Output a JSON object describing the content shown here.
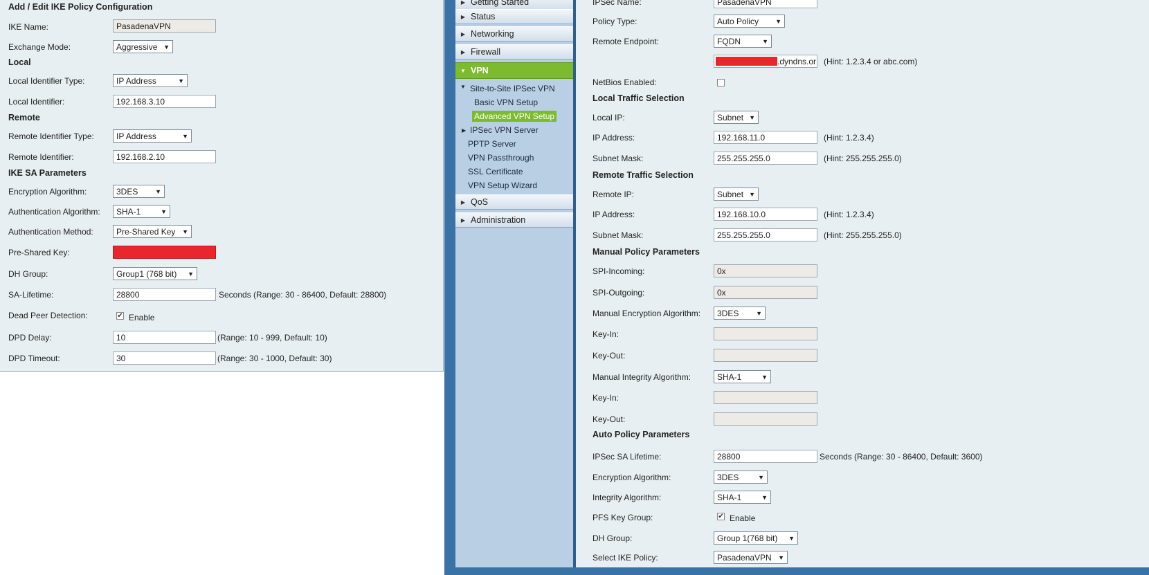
{
  "ike": {
    "title": "Add / Edit IKE Policy Configuration",
    "ike_name_label": "IKE Name:",
    "ike_name_value": "PasadenaVPN",
    "exchange_mode_label": "Exchange Mode:",
    "exchange_mode_value": "Aggressive",
    "local_heading": "Local",
    "local_id_type_label": "Local Identifier Type:",
    "local_id_type_value": "IP Address",
    "local_id_label": "Local Identifier:",
    "local_id_value": "192.168.3.10",
    "remote_heading": "Remote",
    "remote_id_type_label": "Remote Identifier Type:",
    "remote_id_type_value": "IP Address",
    "remote_id_label": "Remote Identifier:",
    "remote_id_value": "192.168.2.10",
    "sa_heading": "IKE SA Parameters",
    "enc_alg_label": "Encryption Algorithm:",
    "enc_alg_value": "3DES",
    "auth_alg_label": "Authentication Algorithm:",
    "auth_alg_value": "SHA-1",
    "auth_method_label": "Authentication Method:",
    "auth_method_value": "Pre-Shared Key",
    "psk_label": "Pre-Shared Key:",
    "dh_label": "DH Group:",
    "dh_value": "Group1 (768 bit)",
    "sa_lifetime_label": "SA-Lifetime:",
    "sa_lifetime_value": "28800",
    "sa_lifetime_hint": "Seconds  (Range: 30 - 86400, Default: 28800)",
    "dpd_label": "Dead Peer Detection:",
    "dpd_enable": "Enable",
    "dpd_delay_label": "DPD Delay:",
    "dpd_delay_value": "10",
    "dpd_delay_hint": "(Range: 10 - 999, Default: 10)",
    "dpd_timeout_label": "DPD Timeout:",
    "dpd_timeout_value": "30",
    "dpd_timeout_hint": "(Range: 30 - 1000, Default: 30)"
  },
  "nav": {
    "getting_started": "Getting Started",
    "status": "Status",
    "networking": "Networking",
    "firewall": "Firewall",
    "vpn": "VPN",
    "site_to_site": "Site-to-Site IPSec VPN",
    "basic_setup": "Basic VPN Setup",
    "advanced_setup": "Advanced VPN Setup",
    "ipsec_server": "IPSec VPN Server",
    "pptp": "PPTP Server",
    "passthrough": "VPN Passthrough",
    "ssl_cert": "SSL Certificate",
    "wizard": "VPN Setup Wizard",
    "qos": "QoS",
    "administration": "Administration"
  },
  "ipsec": {
    "name_label": "IPSec Name:",
    "name_value": "PasadenaVPN",
    "policy_type_label": "Policy Type:",
    "policy_type_value": "Auto Policy",
    "remote_endpoint_label": "Remote Endpoint:",
    "remote_endpoint_value": "FQDN",
    "endpoint_addr_suffix": ".dyndns.or",
    "endpoint_hint": "(Hint: 1.2.3.4 or abc.com)",
    "netbios_label": "NetBios Enabled:",
    "local_traffic_heading": "Local Traffic Selection",
    "local_ip_label": "Local IP:",
    "local_ip_value": "Subnet",
    "local_addr_label": "IP Address:",
    "local_addr_value": "192.168.11.0",
    "local_addr_hint": "(Hint: 1.2.3.4)",
    "local_mask_label": "Subnet Mask:",
    "local_mask_value": "255.255.255.0",
    "local_mask_hint": "(Hint: 255.255.255.0)",
    "remote_traffic_heading": "Remote Traffic Selection",
    "remote_ip_label": "Remote IP:",
    "remote_ip_value": "Subnet",
    "remote_addr_label": "IP Address:",
    "remote_addr_value": "192.168.10.0",
    "remote_addr_hint": "(Hint: 1.2.3.4)",
    "remote_mask_label": "Subnet Mask:",
    "remote_mask_value": "255.255.255.0",
    "remote_mask_hint": "(Hint: 255.255.255.0)",
    "manual_heading": "Manual Policy Parameters",
    "spi_in_label": "SPI-Incoming:",
    "spi_in_value": "0x",
    "spi_out_label": "SPI-Outgoing:",
    "spi_out_value": "0x",
    "manual_enc_label": "Manual Encryption Algorithm:",
    "manual_enc_value": "3DES",
    "key_in_1_label": "Key-In:",
    "key_out_1_label": "Key-Out:",
    "manual_int_label": "Manual Integrity Algorithm:",
    "manual_int_value": "SHA-1",
    "key_in_2_label": "Key-In:",
    "key_out_2_label": "Key-Out:",
    "auto_heading": "Auto Policy Parameters",
    "sa_lifetime_label": "IPSec SA Lifetime:",
    "sa_lifetime_value": "28800",
    "sa_lifetime_hint": "Seconds  (Range: 30 - 86400, Default: 3600)",
    "enc_label": "Encryption Algorithm:",
    "enc_value": "3DES",
    "int_label": "Integrity Algorithm:",
    "int_value": "SHA-1",
    "pfs_label": "PFS Key Group:",
    "pfs_enable": "Enable",
    "dh_label": "DH Group:",
    "dh_value": "Group 1(768 bit)",
    "ike_policy_label": "Select IKE Policy:",
    "ike_policy_value": "PasadenaVPN"
  },
  "icons": {
    "dropdown": "chevron-down-icon",
    "collapsed": "triangle-right-icon",
    "expanded": "triangle-down-icon",
    "checkbox": "checkbox-icon"
  },
  "colors": {
    "panel_bg": "#e8eff3",
    "nav_bg": "#b9cfe4",
    "nav_frame": "#3a72a6",
    "active_green": "#7cbb2e",
    "redacted": "#e8262b"
  }
}
